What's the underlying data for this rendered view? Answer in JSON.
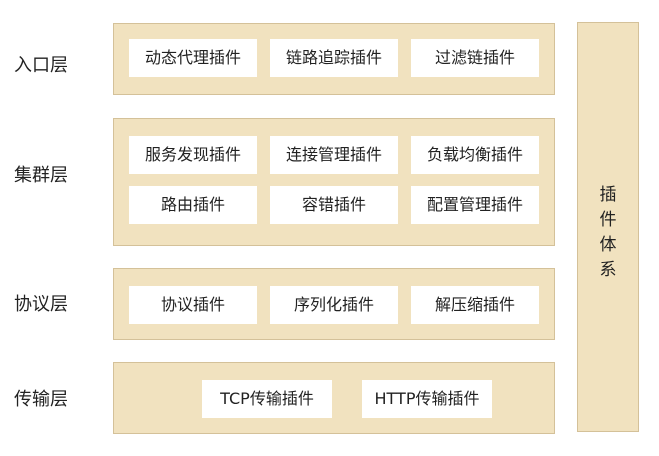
{
  "layers": {
    "entry": {
      "label": "入口层",
      "plugins": [
        "动态代理插件",
        "链路追踪插件",
        "过滤链插件"
      ]
    },
    "cluster": {
      "label": "集群层",
      "plugins": [
        "服务发现插件",
        "连接管理插件",
        "负载均衡插件",
        "路由插件",
        "容错插件",
        "配置管理插件"
      ]
    },
    "protocol": {
      "label": "协议层",
      "plugins": [
        "协议插件",
        "序列化插件",
        "解压缩插件"
      ]
    },
    "transport": {
      "label": "传输层",
      "plugins": [
        "TCP传输插件",
        "HTTP传输插件"
      ]
    }
  },
  "plugin_system": {
    "chars": [
      "插",
      "件",
      "体",
      "系"
    ]
  },
  "colors": {
    "band_fill": "#f1e2bf",
    "band_border": "#d4c199",
    "chip_fill": "#ffffff",
    "text": "#222222"
  }
}
